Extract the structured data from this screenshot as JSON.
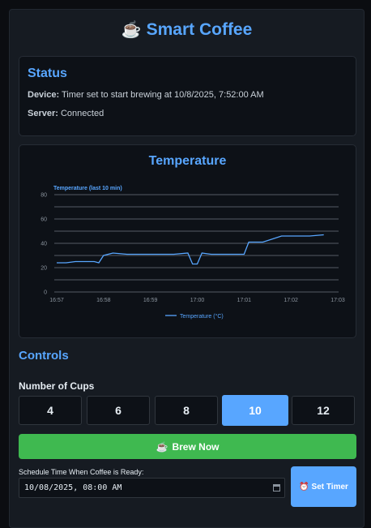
{
  "header": {
    "icon": "coffee-cup-icon",
    "icon_glyph": "☕",
    "title": "Smart Coffee"
  },
  "status": {
    "heading": "Status",
    "device_label": "Device:",
    "device_value": "Timer set to start brewing at 10/8/2025, 7:52:00 AM",
    "server_label": "Server:",
    "server_value": "Connected"
  },
  "temperature": {
    "heading": "Temperature"
  },
  "chart_data": {
    "type": "line",
    "title": "Temperature (last 10 min)",
    "legend": "Temperature (°C)",
    "legend_position": "bottom",
    "ylim": [
      0,
      80
    ],
    "y_ticks": [
      0,
      20,
      40,
      60,
      80
    ],
    "x_ticks": [
      "16:57",
      "16:58",
      "16:59",
      "17:00",
      "17:01",
      "17:02",
      "17:03"
    ],
    "grid": true,
    "color": "#58a6ff",
    "series": [
      {
        "x": [
          0,
          0.2,
          0.4,
          0.6,
          0.8,
          0.9,
          1.0,
          1.2,
          1.5,
          2.0,
          2.5,
          2.8,
          2.9,
          3.0,
          3.1,
          3.3,
          3.6,
          3.8,
          4.0,
          4.1,
          4.3,
          4.4,
          4.8,
          5.0,
          5.4,
          5.7
        ],
        "y": [
          24,
          24,
          25,
          25,
          25,
          24,
          30,
          32,
          31,
          31,
          31,
          32,
          23,
          23,
          32,
          31,
          31,
          31,
          31,
          41,
          41,
          41,
          46,
          46,
          46,
          47
        ]
      }
    ]
  },
  "controls": {
    "heading": "Controls",
    "cups_label": "Number of Cups",
    "cups_options": [
      "4",
      "6",
      "8",
      "10",
      "12"
    ],
    "selected_cups": "10",
    "brew_icon": "☕",
    "brew_label": "Brew Now",
    "schedule_label": "Schedule Time When Coffee is Ready:",
    "schedule_value": "10/08/2025, 08:00 AM",
    "timer_icon": "⏰",
    "timer_label": "Set Timer"
  }
}
